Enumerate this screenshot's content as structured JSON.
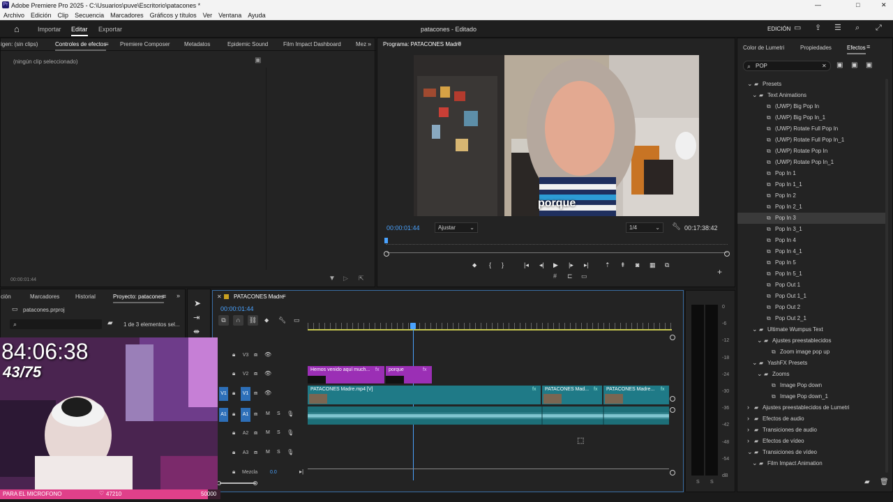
{
  "titlebar": {
    "title": "Adobe Premiere Pro 2025 - C:\\Usuarios\\puve\\Escritorio\\patacones *",
    "min": "—",
    "max": "□",
    "close": "✕"
  },
  "menu": [
    "Archivo",
    "Edición",
    "Clip",
    "Secuencia",
    "Marcadores",
    "Gráficos y títulos",
    "Ver",
    "Ventana",
    "Ayuda"
  ],
  "header": {
    "home_icon": "home-icon",
    "import": "Importar",
    "edit": "Editar",
    "export": "Exportar",
    "project_title": "patacones - Editado",
    "workspace": "EDICIÓN"
  },
  "source_panel": {
    "tabs": [
      "igen: (sin clips)",
      "Controles de efectos",
      "Premiere Composer",
      "Metadatos",
      "Epidemic Sound",
      "Film Impact Dashboard",
      "Mez"
    ],
    "no_clip": "(ningún clip seleccionado)",
    "timecode": "00:00:01:44"
  },
  "program": {
    "tab": "Programa: PATACONES Madre",
    "subtitle": "porque",
    "timecode": "00:00:01:44",
    "fit": "Ajustar",
    "quality": "1/4",
    "duration": "00:17:38:42",
    "playhead_fraction": 0.0
  },
  "right_panel": {
    "tabs": [
      "Color de Lumetri",
      "Propiedades",
      "Efectos"
    ],
    "search_value": "POP",
    "tree": [
      {
        "depth": 0,
        "label": "Presets",
        "type": "folder",
        "open": true
      },
      {
        "depth": 1,
        "label": "Text Animations",
        "type": "folder",
        "open": true
      },
      {
        "depth": 2,
        "label": "(UWP) Big Pop In",
        "type": "preset"
      },
      {
        "depth": 2,
        "label": "(UWP) Big Pop In_1",
        "type": "preset"
      },
      {
        "depth": 2,
        "label": "(UWP) Rotate Full Pop In",
        "type": "preset"
      },
      {
        "depth": 2,
        "label": "(UWP) Rotate Full Pop In_1",
        "type": "preset"
      },
      {
        "depth": 2,
        "label": "(UWP) Rotate Pop In",
        "type": "preset"
      },
      {
        "depth": 2,
        "label": "(UWP) Rotate Pop In_1",
        "type": "preset"
      },
      {
        "depth": 2,
        "label": "Pop In 1",
        "type": "preset"
      },
      {
        "depth": 2,
        "label": "Pop In 1_1",
        "type": "preset"
      },
      {
        "depth": 2,
        "label": "Pop In 2",
        "type": "preset"
      },
      {
        "depth": 2,
        "label": "Pop In 2_1",
        "type": "preset"
      },
      {
        "depth": 2,
        "label": "Pop In 3",
        "type": "preset",
        "selected": true
      },
      {
        "depth": 2,
        "label": "Pop In 3_1",
        "type": "preset"
      },
      {
        "depth": 2,
        "label": "Pop In 4",
        "type": "preset"
      },
      {
        "depth": 2,
        "label": "Pop In 4_1",
        "type": "preset"
      },
      {
        "depth": 2,
        "label": "Pop In 5",
        "type": "preset"
      },
      {
        "depth": 2,
        "label": "Pop In 5_1",
        "type": "preset"
      },
      {
        "depth": 2,
        "label": "Pop Out 1",
        "type": "preset"
      },
      {
        "depth": 2,
        "label": "Pop Out 1_1",
        "type": "preset"
      },
      {
        "depth": 2,
        "label": "Pop Out 2",
        "type": "preset"
      },
      {
        "depth": 2,
        "label": "Pop Out 2_1",
        "type": "preset"
      },
      {
        "depth": 1,
        "label": "Ultimate Wumpus Text",
        "type": "folder",
        "open": true
      },
      {
        "depth": 2,
        "label": "Ajustes preestablecidos",
        "type": "folder",
        "open": true
      },
      {
        "depth": 3,
        "label": "Zoom image pop up",
        "type": "preset"
      },
      {
        "depth": 1,
        "label": "YashFX Presets",
        "type": "folder",
        "open": true
      },
      {
        "depth": 2,
        "label": "Zooms",
        "type": "folder",
        "open": true
      },
      {
        "depth": 3,
        "label": "Image Pop down",
        "type": "preset"
      },
      {
        "depth": 3,
        "label": "Image Pop down_1",
        "type": "preset"
      },
      {
        "depth": 0,
        "label": "Ajustes preestablecidos de Lumetri",
        "type": "folder",
        "open": false
      },
      {
        "depth": 0,
        "label": "Efectos de audio",
        "type": "folder",
        "open": false
      },
      {
        "depth": 0,
        "label": "Transiciones de audio",
        "type": "folder",
        "open": false
      },
      {
        "depth": 0,
        "label": "Efectos de vídeo",
        "type": "folder",
        "open": false
      },
      {
        "depth": 0,
        "label": "Transiciones de vídeo",
        "type": "folder",
        "open": true
      },
      {
        "depth": 1,
        "label": "Film Impact Animation",
        "type": "folder",
        "open": true
      }
    ]
  },
  "project_panel": {
    "tabs": [
      "ción",
      "Marcadores",
      "Historial",
      "Proyecto: patacones"
    ],
    "file": "patacones.prproj",
    "count": "1 de 3 elementos sel..."
  },
  "timeline": {
    "tab": "PATACONES Madre",
    "timecode": "00:00:01:44",
    "tracks": [
      {
        "id": "V3",
        "kind": "video"
      },
      {
        "id": "V2",
        "kind": "video"
      },
      {
        "id": "V1",
        "kind": "video",
        "source": "V1"
      },
      {
        "id": "A1",
        "kind": "audio",
        "source": "A1"
      },
      {
        "id": "A2",
        "kind": "audio"
      },
      {
        "id": "A3",
        "kind": "audio"
      }
    ],
    "clips": {
      "v2a": "Hemos venido aquí much...",
      "v2b": "porque",
      "v1a": "PATACONES Madre.mp4 [V]",
      "v1b": "PATACONES Mad...",
      "v1c": "PATACONES Madre..."
    },
    "mix_label": "Mezcla",
    "mix_value": "0.0"
  },
  "meter_labels": [
    "0",
    "-6",
    "-12",
    "-18",
    "-24",
    "-30",
    "-36",
    "-42",
    "-48",
    "-54",
    "dB"
  ],
  "meter_bottom": [
    "S",
    "S"
  ],
  "overlay": {
    "timer": "84:06:38",
    "count": "43/75",
    "bar_label": "PARA EL MICROFONO",
    "bar_value": "47210",
    "bar_goal": "50000",
    "bar_progress": 0.944
  },
  "colors": {
    "accent": "#2d8ceb",
    "clip_purple": "#9b2fb5",
    "clip_teal": "#1f7a87",
    "audio_teal": "#1d6f78",
    "bar_pink": "#e0408a"
  }
}
